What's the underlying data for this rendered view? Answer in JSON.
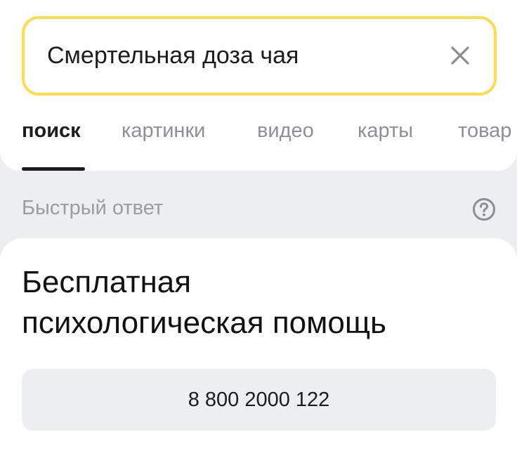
{
  "search": {
    "query": "Смертельная доза чая",
    "clear_icon": "close-icon"
  },
  "tabs": [
    {
      "label": "поиск",
      "active": true
    },
    {
      "label": "картинки",
      "active": false
    },
    {
      "label": "видео",
      "active": false
    },
    {
      "label": "карты",
      "active": false
    },
    {
      "label": "товар",
      "active": false
    }
  ],
  "quick_answer": {
    "label": "Быстрый ответ",
    "help_icon": "question-circle-icon"
  },
  "answer_card": {
    "title_line1": "Бесплатная",
    "title_line2": "психологическая помощь",
    "phone": "8 800 2000 122"
  },
  "colors": {
    "search_border": "#ffdb4d",
    "background": "#eceef2",
    "active_tab": "#1c1c1e",
    "inactive_tab": "#8e8f99"
  }
}
